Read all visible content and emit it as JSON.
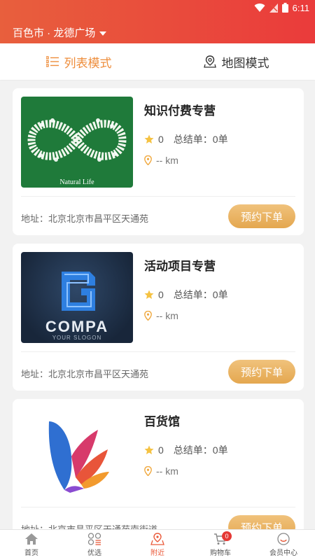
{
  "status_bar": {
    "time": "6:11"
  },
  "header": {
    "location": "百色市 · 龙德广场"
  },
  "tabs": [
    {
      "label": "列表模式",
      "active": true
    },
    {
      "label": "地图模式",
      "active": false
    }
  ],
  "stores": [
    {
      "name": "知识付费专营",
      "rating": "0",
      "orders_label": "总结单：",
      "orders": "0单",
      "distance": "-- km",
      "address": "地址：北京北京市昌平区天通苑",
      "button": "预约下单",
      "image_caption": "Natural Life"
    },
    {
      "name": "活动项目专营",
      "rating": "0",
      "orders_label": "总结单：",
      "orders": "0单",
      "distance": "-- km",
      "address": "地址：北京北京市昌平区天通苑",
      "button": "预约下单",
      "image_caption": "COMPA",
      "image_subcaption": "YOUR SLOGON"
    },
    {
      "name": "百货馆",
      "rating": "0",
      "orders_label": "总结单：",
      "orders": "0单",
      "distance": "-- km",
      "address": "地址：北京市昌平区天通苑南街道",
      "button": "预约下单"
    }
  ],
  "bottom_nav": [
    {
      "label": "首页",
      "icon": "home-icon"
    },
    {
      "label": "优选",
      "icon": "grid-icon"
    },
    {
      "label": "附近",
      "icon": "location-icon",
      "active": true
    },
    {
      "label": "购物车",
      "icon": "cart-icon",
      "badge": "0"
    },
    {
      "label": "会员中心",
      "icon": "member-icon"
    }
  ],
  "colors": {
    "accent": "#ee8d3b",
    "header": "#ea3b3b",
    "button": "#e4a74f"
  }
}
